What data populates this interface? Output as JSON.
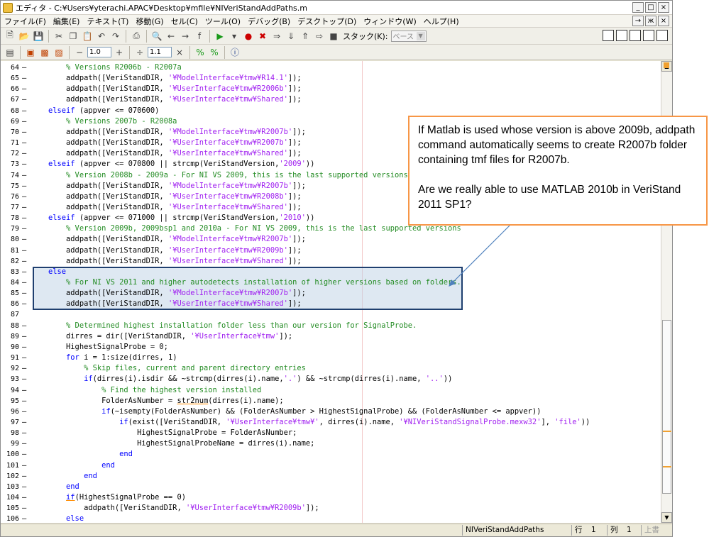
{
  "window": {
    "title": "エディタ - C:¥Users¥yterachi.APAC¥Desktop¥mfile¥NIVeriStandAddPaths.m",
    "buttons": [
      "_",
      "□",
      "×"
    ]
  },
  "menubar": {
    "items": [
      "ファイル(F)",
      "編集(E)",
      "テキスト(T)",
      "移動(G)",
      "セル(C)",
      "ツール(O)",
      "デバッグ(B)",
      "デスクトップ(D)",
      "ウィンドウ(W)",
      "ヘルプ(H)"
    ],
    "right_buttons": [
      "→",
      "ж",
      "×"
    ]
  },
  "toolbar1": {
    "stack_label": "スタック(K):",
    "stack_value": "ベース"
  },
  "toolbar2": {
    "minus": "−",
    "plus": "+",
    "spacing_value": "1.0",
    "divide": "÷",
    "scale_value": "1.1",
    "times": "×"
  },
  "editor": {
    "lines": [
      {
        "n": "64",
        "t": [
          [
            "        ",
            ""
          ],
          [
            "% Versions R2006b - R2007a",
            "cm"
          ]
        ]
      },
      {
        "n": "65",
        "t": [
          [
            "        addpath([VeriStandDIR, ",
            ""
          ],
          [
            "'¥ModelInterface¥tmw¥R14.1'",
            "str"
          ],
          [
            "]);",
            ""
          ]
        ]
      },
      {
        "n": "66",
        "t": [
          [
            "        addpath([VeriStandDIR, ",
            ""
          ],
          [
            "'¥UserInterface¥tmw¥R2006b'",
            "str"
          ],
          [
            "]);",
            ""
          ]
        ]
      },
      {
        "n": "67",
        "t": [
          [
            "        addpath([VeriStandDIR, ",
            ""
          ],
          [
            "'¥UserInterface¥tmw¥Shared'",
            "str"
          ],
          [
            "]);",
            ""
          ]
        ]
      },
      {
        "n": "68",
        "t": [
          [
            "    ",
            ""
          ],
          [
            "elseif",
            "kw"
          ],
          [
            " (appver <= 070600)",
            ""
          ]
        ]
      },
      {
        "n": "69",
        "t": [
          [
            "        ",
            ""
          ],
          [
            "% Versions 2007b - R2008a",
            "cm"
          ]
        ]
      },
      {
        "n": "70",
        "t": [
          [
            "        addpath([VeriStandDIR, ",
            ""
          ],
          [
            "'¥ModelInterface¥tmw¥R2007b'",
            "str"
          ],
          [
            "]);",
            ""
          ]
        ]
      },
      {
        "n": "71",
        "t": [
          [
            "        addpath([VeriStandDIR, ",
            ""
          ],
          [
            "'¥UserInterface¥tmw¥R2007b'",
            "str"
          ],
          [
            "]);",
            ""
          ]
        ]
      },
      {
        "n": "72",
        "t": [
          [
            "        addpath([VeriStandDIR, ",
            ""
          ],
          [
            "'¥UserInterface¥tmw¥Shared'",
            "str"
          ],
          [
            "]);",
            ""
          ]
        ]
      },
      {
        "n": "73",
        "t": [
          [
            "    ",
            ""
          ],
          [
            "elseif",
            "kw"
          ],
          [
            " (appver <= 070800 || strcmp(VeriStandVersion,",
            ""
          ],
          [
            "'2009'",
            "str"
          ],
          [
            "))",
            ""
          ]
        ]
      },
      {
        "n": "74",
        "t": [
          [
            "        ",
            ""
          ],
          [
            "% Version 2008b - 2009a - For NI VS 2009, this is the last supported versions",
            "cm"
          ]
        ]
      },
      {
        "n": "75",
        "t": [
          [
            "        addpath([VeriStandDIR, ",
            ""
          ],
          [
            "'¥ModelInterface¥tmw¥R2007b'",
            "str"
          ],
          [
            "]);",
            ""
          ]
        ]
      },
      {
        "n": "76",
        "t": [
          [
            "        addpath([VeriStandDIR, ",
            ""
          ],
          [
            "'¥UserInterface¥tmw¥R2008b'",
            "str"
          ],
          [
            "]);",
            ""
          ]
        ]
      },
      {
        "n": "77",
        "t": [
          [
            "        addpath([VeriStandDIR, ",
            ""
          ],
          [
            "'¥UserInterface¥tmw¥Shared'",
            "str"
          ],
          [
            "]);",
            ""
          ]
        ]
      },
      {
        "n": "78",
        "t": [
          [
            "    ",
            ""
          ],
          [
            "elseif",
            "kw"
          ],
          [
            " (appver <= 071000 || strcmp(VeriStandVersion,",
            ""
          ],
          [
            "'2010'",
            "str"
          ],
          [
            "))",
            ""
          ]
        ]
      },
      {
        "n": "79",
        "t": [
          [
            "        ",
            ""
          ],
          [
            "% Version 2009b, 2009bsp1 and 2010a - For NI VS 2009, this is the last supported versions",
            "cm"
          ]
        ]
      },
      {
        "n": "80",
        "t": [
          [
            "        addpath([VeriStandDIR, ",
            ""
          ],
          [
            "'¥ModelInterface¥tmw¥R2007b'",
            "str"
          ],
          [
            "]);",
            ""
          ]
        ]
      },
      {
        "n": "81",
        "t": [
          [
            "        addpath([VeriStandDIR, ",
            ""
          ],
          [
            "'¥UserInterface¥tmw¥R2009b'",
            "str"
          ],
          [
            "]);",
            ""
          ]
        ]
      },
      {
        "n": "82",
        "t": [
          [
            "        addpath([VeriStandDIR, ",
            ""
          ],
          [
            "'¥UserInterface¥tmw¥Shared'",
            "str"
          ],
          [
            "]);",
            ""
          ]
        ]
      },
      {
        "n": "83",
        "t": [
          [
            "    ",
            ""
          ],
          [
            "else",
            "kw"
          ]
        ]
      },
      {
        "n": "84",
        "t": [
          [
            "        ",
            ""
          ],
          [
            "% For NI VS 2011 and higher autodetects installation of higher versions based on folders.",
            "cm"
          ]
        ]
      },
      {
        "n": "85",
        "t": [
          [
            "        addpath([VeriStandDIR, ",
            ""
          ],
          [
            "'¥ModelInterface¥tmw¥R2007b'",
            "str"
          ],
          [
            "]);",
            ""
          ]
        ]
      },
      {
        "n": "86",
        "t": [
          [
            "        addpath([VeriStandDIR, ",
            ""
          ],
          [
            "'¥UserInterface¥tmw¥Shared'",
            "str"
          ],
          [
            "]);",
            ""
          ]
        ]
      },
      {
        "n": "87",
        "t": []
      },
      {
        "n": "88",
        "t": [
          [
            "        ",
            ""
          ],
          [
            "% Determined highest installation folder less than our version for SignalProbe.",
            "cm"
          ]
        ]
      },
      {
        "n": "89",
        "t": [
          [
            "        dirres = dir([VeriStandDIR, ",
            ""
          ],
          [
            "'¥UserInterface¥tmw'",
            "str"
          ],
          [
            "]);",
            ""
          ]
        ]
      },
      {
        "n": "90",
        "t": [
          [
            "        HighestSignalProbe = 0;",
            ""
          ]
        ]
      },
      {
        "n": "91",
        "t": [
          [
            "        ",
            ""
          ],
          [
            "for",
            "kw"
          ],
          [
            " i = 1:size(dirres, 1)",
            ""
          ]
        ]
      },
      {
        "n": "92",
        "t": [
          [
            "            ",
            ""
          ],
          [
            "% Skip files, current and parent directory entries",
            "cm"
          ]
        ]
      },
      {
        "n": "93",
        "t": [
          [
            "            ",
            ""
          ],
          [
            "if",
            "kw"
          ],
          [
            "(dirres(i).isdir && ~strcmp(dirres(i).name,",
            ""
          ],
          [
            "'.'",
            "str"
          ],
          [
            ") && ~strcmp(dirres(i).name, ",
            ""
          ],
          [
            "'..'",
            "str"
          ],
          [
            "))",
            ""
          ]
        ]
      },
      {
        "n": "94",
        "t": [
          [
            "                ",
            ""
          ],
          [
            "% Find the highest version installed",
            "cm"
          ]
        ]
      },
      {
        "n": "95",
        "t": [
          [
            "                FolderAsNumber = ",
            ""
          ],
          [
            "str2num",
            "err"
          ],
          [
            "(dirres(i).name);",
            ""
          ]
        ]
      },
      {
        "n": "96",
        "t": [
          [
            "                ",
            ""
          ],
          [
            "if",
            "kw"
          ],
          [
            "(~isempty(FolderAsNumber) && (FolderAsNumber > HighestSignalProbe) && (FolderAsNumber <= appver))",
            ""
          ]
        ]
      },
      {
        "n": "97",
        "t": [
          [
            "                    ",
            ""
          ],
          [
            "if",
            "kw"
          ],
          [
            "(exist([VeriStandDIR, ",
            ""
          ],
          [
            "'¥UserInterface¥tmw¥'",
            "str"
          ],
          [
            ", dirres(i).name, ",
            ""
          ],
          [
            "'¥NIVeriStandSignalProbe.mexw32'",
            "str"
          ],
          [
            "], ",
            ""
          ],
          [
            "'file'",
            "str"
          ],
          [
            "))",
            ""
          ]
        ]
      },
      {
        "n": "98",
        "t": [
          [
            "                        HighestSignalProbe = FolderAsNumber;",
            ""
          ]
        ]
      },
      {
        "n": "99",
        "t": [
          [
            "                        HighestSignalProbeName = dirres(i).name;",
            ""
          ]
        ]
      },
      {
        "n": "100",
        "t": [
          [
            "                    ",
            ""
          ],
          [
            "end",
            "kw"
          ]
        ]
      },
      {
        "n": "101",
        "t": [
          [
            "                ",
            ""
          ],
          [
            "end",
            "kw"
          ]
        ]
      },
      {
        "n": "102",
        "t": [
          [
            "            ",
            ""
          ],
          [
            "end",
            "kw"
          ]
        ]
      },
      {
        "n": "103",
        "t": [
          [
            "        ",
            ""
          ],
          [
            "end",
            "kw"
          ]
        ]
      },
      {
        "n": "104",
        "t": [
          [
            "        ",
            ""
          ],
          [
            "if",
            "kw err"
          ],
          [
            "(HighestSignalProbe == 0)",
            ""
          ]
        ]
      },
      {
        "n": "105",
        "t": [
          [
            "            addpath([VeriStandDIR, ",
            ""
          ],
          [
            "'¥UserInterface¥tmw¥R2009b'",
            "str"
          ],
          [
            "]);",
            ""
          ]
        ]
      },
      {
        "n": "106",
        "t": [
          [
            "        ",
            ""
          ],
          [
            "else",
            "kw"
          ]
        ]
      }
    ]
  },
  "statusbar": {
    "file": "NIVeriStandAddPaths",
    "row_label": "行",
    "row": "1",
    "col_label": "列",
    "col": "1",
    "mode": "上書"
  },
  "callout": {
    "paragraph1": "If Matlab is used whose version is above 2009b, addpath command automatically seems to create R2007b folder containing tmf files for R2007b.",
    "paragraph2": "Are we really able to use MATLAB 2010b in VeriStand 2011 SP1?"
  },
  "colors": {
    "keyword": "#0000ff",
    "string": "#a020f0",
    "comment": "#228b22",
    "callout_border": "#f79646",
    "highlight_border": "#1f3f6f"
  }
}
